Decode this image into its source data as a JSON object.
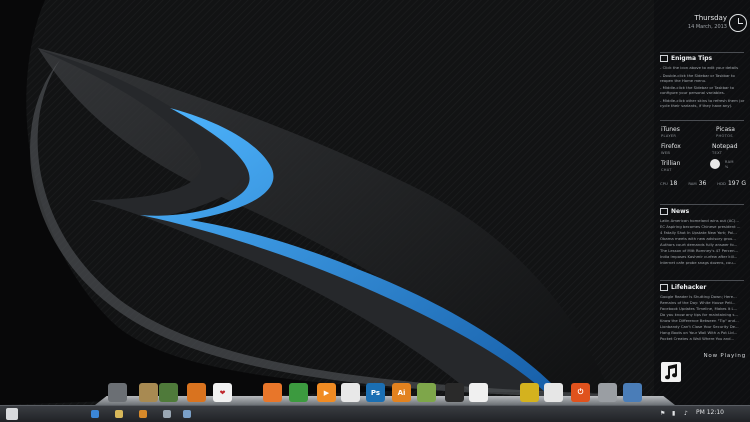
{
  "sidebar": {
    "clock": {
      "day": "Thursday",
      "date": "14 March, 2013"
    },
    "tips": {
      "title": "Enigma Tips",
      "lines": [
        "- Click the icon above to edit your details",
        "- Double-click the Sidebar or Taskbar to reopen the Home menu.",
        "- Middle-click the Sidebar or Taskbar to configure your personal variables.",
        "- Middle-click other skins to refresh them (or cycle their variants, if they have any)."
      ]
    },
    "launchers": [
      {
        "name": "iTunes",
        "sub": "PLAYER"
      },
      {
        "name": "Picasa",
        "sub": "PHOTOS"
      },
      {
        "name": "Firefox",
        "sub": "WEB"
      },
      {
        "name": "Notepad",
        "sub": "TEXT"
      },
      {
        "name": "Trillian",
        "sub": "CHAT"
      },
      {
        "name": "RAM",
        "sub": "%"
      }
    ],
    "stats": {
      "cpu_label": "CPU",
      "cpu_value": "18",
      "ram_label": "RAM",
      "ram_value": "36",
      "hdd_label": "HDD",
      "hdd_value": "197 G"
    },
    "news": {
      "title": "News",
      "items": [
        "Latin American homeland wins out (AC)...",
        "EC Aspiring becomes Chinese president ...",
        "4 Fatally Shot In Upstate New York; Pol...",
        "Obama meets with new advisory grou...",
        "Authors court demands fully answer fo...",
        "The Lesson of Mitt Romney's 47 Percen...",
        "India imposes Kashmir curfew after kill...",
        "Internet cafe probe snags dozens, cou..."
      ]
    },
    "lifehacker": {
      "title": "Lifehacker",
      "items": [
        "Google Reader Is Shutting Down; Here...",
        "Remains of the Day: White House Peti...",
        "Facebook Updates Timeline, Makes It L...",
        "Do you know any tips for maintaining s...",
        "Know the Difference Between \"Tip\" and...",
        "Lionbandy Can't Close Your Security De...",
        "Hang Boots on Your Wall With a Pot Lid...",
        "Pocket Creates a Wall Where You and..."
      ]
    },
    "now_playing": "Now Playing"
  },
  "dock": {
    "items": [
      {
        "name": "monitor-icon",
        "glyph": "",
        "color": "#6b6f74"
      },
      {
        "name": "folder-icon",
        "glyph": "",
        "color": "#a88a52"
      },
      {
        "name": "movie-icon",
        "glyph": "",
        "color": "#4f7a3a"
      },
      {
        "name": "speaker-icon",
        "glyph": "",
        "color": "#d9731f"
      },
      {
        "name": "heart-icon",
        "glyph": "❤",
        "color": "#f1f1f1"
      },
      {
        "name": "firefox-icon",
        "glyph": "",
        "color": "#e8762a"
      },
      {
        "name": "chrome-icon",
        "glyph": "",
        "color": "#3c9a3f"
      },
      {
        "name": "media-player-icon",
        "glyph": "▶",
        "color": "#f08b23"
      },
      {
        "name": "itunes-icon",
        "glyph": "",
        "color": "#e8e8e8"
      },
      {
        "name": "photoshop-icon",
        "glyph": "Ps",
        "color": "#1b6fb3"
      },
      {
        "name": "illustrator-icon",
        "glyph": "Ai",
        "color": "#e2821f"
      },
      {
        "name": "mystery-icon",
        "glyph": "",
        "color": "#7ea64a"
      },
      {
        "name": "sketch-icon",
        "glyph": "",
        "color": "#2a2a2a"
      },
      {
        "name": "blank-page-icon",
        "glyph": "",
        "color": "#f0f0f0"
      },
      {
        "name": "gamepad-icon",
        "glyph": "",
        "color": "#d4b21e"
      },
      {
        "name": "clock-icon",
        "glyph": "",
        "color": "#e6e6e6"
      },
      {
        "name": "power-icon",
        "glyph": "⏻",
        "color": "#e0521d"
      },
      {
        "name": "trash-icon",
        "glyph": "",
        "color": "#9a9ea3"
      },
      {
        "name": "settings-icon",
        "glyph": "",
        "color": "#4a7db8"
      }
    ]
  },
  "taskbar": {
    "clock": "PM 12:10",
    "apps": [
      {
        "name": "internet-explorer-icon",
        "color": "#3b86d6"
      },
      {
        "name": "explorer-folder-icon",
        "color": "#d8b85a"
      },
      {
        "name": "media-icon",
        "color": "#d88a2a"
      },
      {
        "name": "network-icon",
        "color": "#9aa7b3"
      },
      {
        "name": "pin-icon",
        "color": "#7aa0c8"
      }
    ]
  },
  "colors": {
    "accent": "#2f8fe6",
    "background": "#0d0d0e"
  }
}
